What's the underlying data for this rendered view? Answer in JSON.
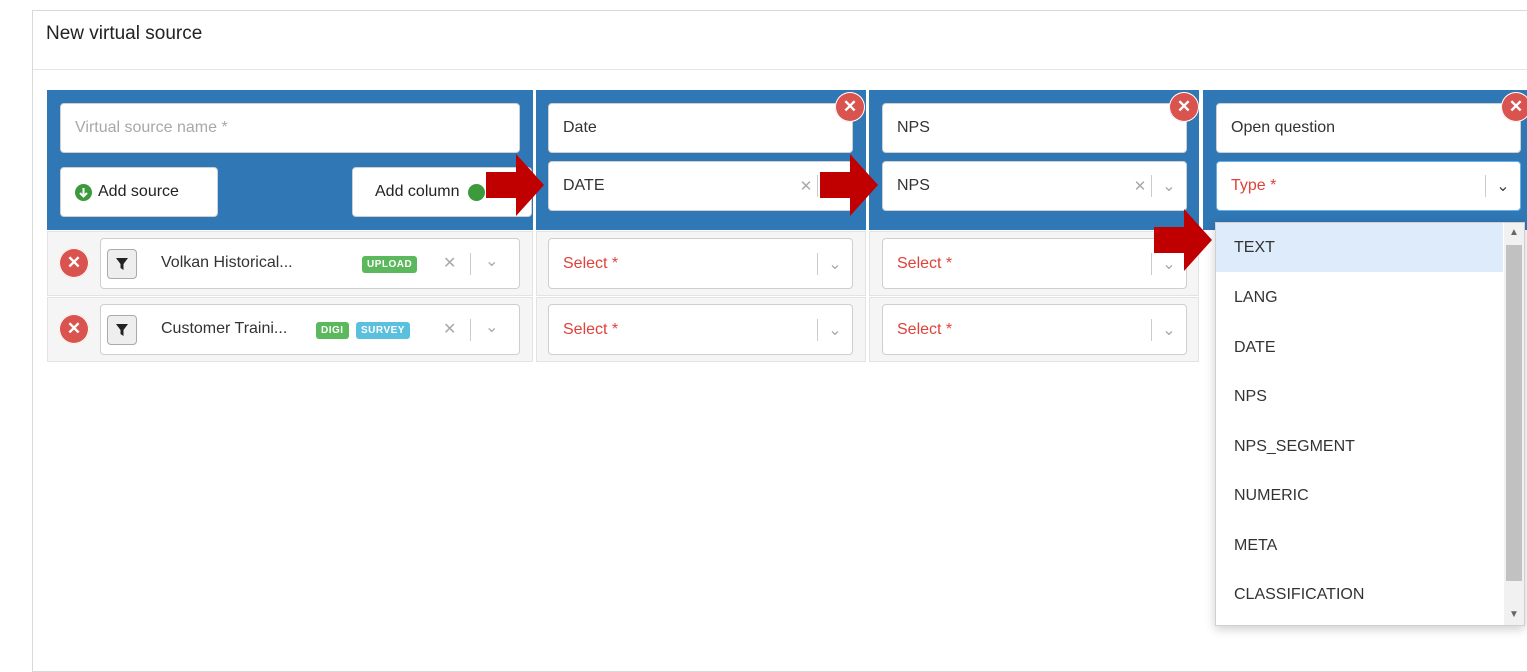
{
  "panel": {
    "title": "New virtual source"
  },
  "source": {
    "name_placeholder": "Virtual source name *",
    "add_source_label": "Add source",
    "add_column_label": "Add column"
  },
  "columns": [
    {
      "name": "Date",
      "type_value": "DATE"
    },
    {
      "name": "NPS",
      "type_value": "NPS"
    },
    {
      "name": "Open question",
      "type_placeholder": "Type *"
    }
  ],
  "rows": [
    {
      "source_name": "Volkan Historical...",
      "badges": [
        "UPLOAD"
      ],
      "cell1": "Select *",
      "cell2": "Select *"
    },
    {
      "source_name": "Customer Traini...",
      "badges": [
        "DIGI",
        "SURVEY"
      ],
      "cell1": "Select *",
      "cell2": "Select *"
    }
  ],
  "dropdown": {
    "options": [
      "TEXT",
      "LANG",
      "DATE",
      "NPS",
      "NPS_SEGMENT",
      "NUMERIC",
      "META",
      "CLASSIFICATION"
    ],
    "highlighted": "TEXT"
  },
  "icons": {
    "remove": "close-icon",
    "filter": "filter-icon",
    "add": "plus-circle-icon",
    "arrow_pointer": "right-arrow-icon"
  },
  "colors": {
    "header_blue": "#2f77b5",
    "remove_red": "#d9534f",
    "required_red": "#e0413a",
    "arrow_red": "#c00000",
    "badge_green": "#5cb85c",
    "badge_blue": "#5bc0de"
  }
}
